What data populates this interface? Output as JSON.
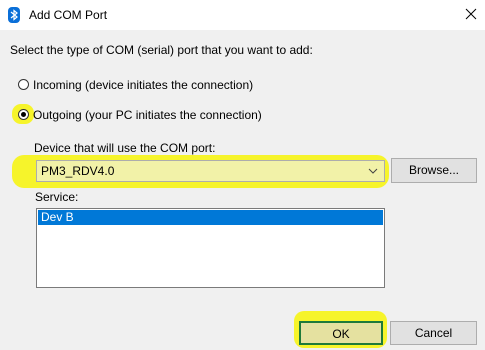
{
  "window": {
    "title": "Add COM Port",
    "icon": "bluetooth-icon",
    "close_icon": "close-icon"
  },
  "dialog": {
    "instruction": "Select the type of COM (serial) port that you want to add:",
    "incoming_label": "Incoming (device initiates the connection)",
    "outgoing_label": "Outgoing (your PC initiates the connection)",
    "selected_option": "outgoing",
    "device_label": "Device that will use the COM port:",
    "device_value": "PM3_RDV4.0",
    "browse_label": "Browse...",
    "service_label": "Service:",
    "service_items": [
      "Dev B"
    ],
    "selected_service": "Dev B",
    "ok_label": "OK",
    "cancel_label": "Cancel"
  },
  "colors": {
    "highlight": "#f6f42b",
    "selection": "#0078d7",
    "dialog_bg": "#f0f0f0"
  }
}
